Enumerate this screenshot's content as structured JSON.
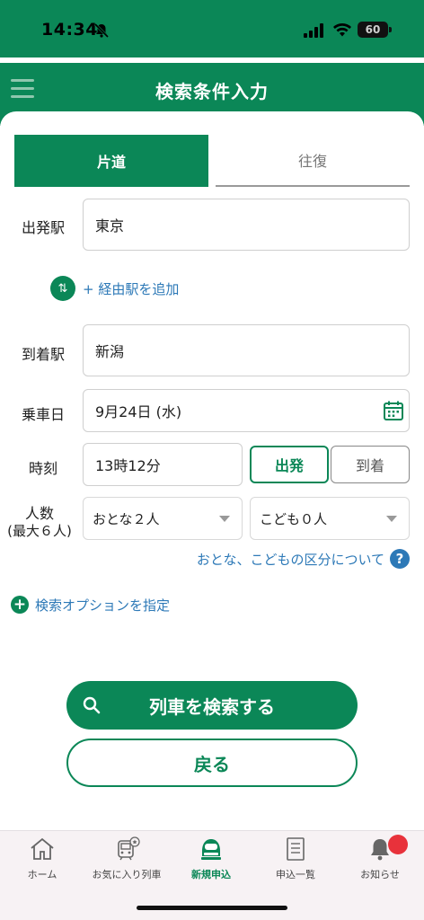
{
  "status_bar": {
    "time": "14:34",
    "battery": "60"
  },
  "header": {
    "title": "検索条件入力"
  },
  "tabs": {
    "one_way": "片道",
    "round_trip": "往復"
  },
  "form": {
    "departure_label": "出発駅",
    "departure_value": "東京",
    "add_via_label": "+ 経由駅を追加",
    "arrival_label": "到着駅",
    "arrival_value": "新潟",
    "date_label": "乗車日",
    "date_value": "9月24日 (水)",
    "time_label": "時刻",
    "time_value": "13時12分",
    "depart_toggle": "出発",
    "arrive_toggle": "到着",
    "passengers_label_1": "人数",
    "passengers_label_2": "(最大６人)",
    "adults_value": "おとな２人",
    "children_value": "こども０人",
    "category_link": "おとな、こどもの区分について",
    "options_link": "検索オプションを指定"
  },
  "actions": {
    "search": "列車を検索する",
    "back": "戻る"
  },
  "bottom_nav": [
    {
      "label": "ホーム",
      "icon": "home-icon"
    },
    {
      "label": "お気に入り列車",
      "icon": "favorite-train-icon"
    },
    {
      "label": "新規申込",
      "icon": "new-application-icon"
    },
    {
      "label": "申込一覧",
      "icon": "application-list-icon"
    },
    {
      "label": "お知らせ",
      "icon": "notification-bell-icon"
    }
  ],
  "colors": {
    "brand": "#0b8757",
    "link": "#2d79b7",
    "badge": "#e8323b"
  }
}
